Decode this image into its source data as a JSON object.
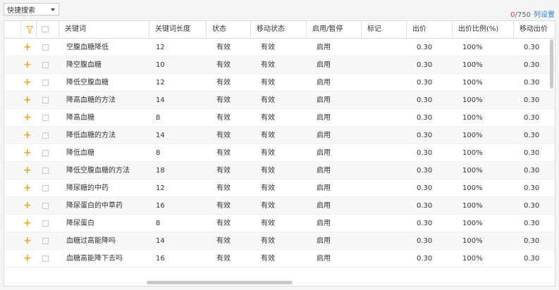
{
  "toolbar": {
    "quick_search_label": "快捷搜索",
    "selected_count": "0",
    "total_count": "/750",
    "column_settings": "列设置"
  },
  "columns": [
    "关键词",
    "关键词长度",
    "状态",
    "移动状态",
    "启用/暂停",
    "标记",
    "出价",
    "出价比例(%)",
    "移动出价"
  ],
  "rows": [
    {
      "keyword": "空腹血糖降低",
      "length": "12",
      "status": "有效",
      "mobile_status": "有效",
      "enabled": "启用",
      "mark": "",
      "bid": "0.30",
      "ratio": "100%",
      "mobile_bid": "0.30"
    },
    {
      "keyword": "降空腹血糖",
      "length": "10",
      "status": "有效",
      "mobile_status": "有效",
      "enabled": "启用",
      "mark": "",
      "bid": "0.30",
      "ratio": "100%",
      "mobile_bid": "0.30"
    },
    {
      "keyword": "降低空腹血糖",
      "length": "12",
      "status": "有效",
      "mobile_status": "有效",
      "enabled": "启用",
      "mark": "",
      "bid": "0.30",
      "ratio": "100%",
      "mobile_bid": "0.30"
    },
    {
      "keyword": "降高血糖的方法",
      "length": "14",
      "status": "有效",
      "mobile_status": "有效",
      "enabled": "启用",
      "mark": "",
      "bid": "0.30",
      "ratio": "100%",
      "mobile_bid": "0.30"
    },
    {
      "keyword": "降高血糖",
      "length": "8",
      "status": "有效",
      "mobile_status": "有效",
      "enabled": "启用",
      "mark": "",
      "bid": "0.30",
      "ratio": "100%",
      "mobile_bid": "0.30"
    },
    {
      "keyword": "降低血糖的方法",
      "length": "14",
      "status": "有效",
      "mobile_status": "有效",
      "enabled": "启用",
      "mark": "",
      "bid": "0.30",
      "ratio": "100%",
      "mobile_bid": "0.30"
    },
    {
      "keyword": "降低血糖",
      "length": "8",
      "status": "有效",
      "mobile_status": "有效",
      "enabled": "启用",
      "mark": "",
      "bid": "0.30",
      "ratio": "100%",
      "mobile_bid": "0.30"
    },
    {
      "keyword": "降低空腹血糖的方法",
      "length": "18",
      "status": "有效",
      "mobile_status": "有效",
      "enabled": "启用",
      "mark": "",
      "bid": "0.30",
      "ratio": "100%",
      "mobile_bid": "0.30"
    },
    {
      "keyword": "降尿糖的中药",
      "length": "12",
      "status": "有效",
      "mobile_status": "有效",
      "enabled": "启用",
      "mark": "",
      "bid": "0.30",
      "ratio": "100%",
      "mobile_bid": "0.30"
    },
    {
      "keyword": "降尿蛋白的中草药",
      "length": "16",
      "status": "有效",
      "mobile_status": "有效",
      "enabled": "启用",
      "mark": "",
      "bid": "0.30",
      "ratio": "100%",
      "mobile_bid": "0.30"
    },
    {
      "keyword": "降尿蛋白",
      "length": "8",
      "status": "有效",
      "mobile_status": "有效",
      "enabled": "启用",
      "mark": "",
      "bid": "0.30",
      "ratio": "100%",
      "mobile_bid": "0.30"
    },
    {
      "keyword": "血糖过高能降吗",
      "length": "14",
      "status": "有效",
      "mobile_status": "有效",
      "enabled": "启用",
      "mark": "",
      "bid": "0.30",
      "ratio": "100%",
      "mobile_bid": "0.30"
    },
    {
      "keyword": "血糖高能降下去吗",
      "length": "16",
      "status": "有效",
      "mobile_status": "有效",
      "enabled": "启用",
      "mark": "",
      "bid": "0.30",
      "ratio": "100%",
      "mobile_bid": "0.30"
    }
  ],
  "colors": {
    "accent": "#2b7fd6",
    "plus": "#f5a623",
    "count": "#e64340"
  },
  "icons": {
    "expand": "plus-icon",
    "filter": "filter-icon",
    "dropdown": "chevron-down-icon"
  }
}
